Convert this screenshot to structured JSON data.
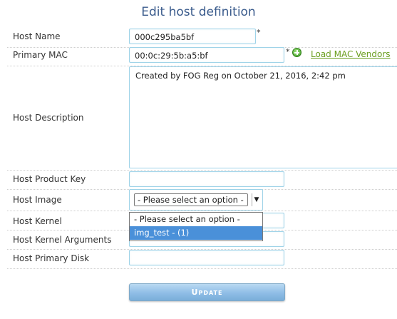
{
  "title": "Edit host definition",
  "fields": {
    "host_name": {
      "label": "Host Name",
      "value": "000c295ba5bf",
      "required": "*"
    },
    "primary_mac": {
      "label": "Primary MAC",
      "value": "00:0c:29:5b:a5:bf",
      "required": "*",
      "link": "Load MAC Vendors"
    },
    "description": {
      "label": "Host Description",
      "value": "Created by FOG Reg on October 21, 2016, 2:42 pm"
    },
    "product_key": {
      "label": "Host Product Key",
      "value": ""
    },
    "image": {
      "label": "Host Image",
      "selected": "- Please select an option -",
      "options": [
        "- Please select an option -",
        "img_test - (1)"
      ]
    },
    "kernel": {
      "label": "Host Kernel",
      "value": ""
    },
    "kernel_args": {
      "label": "Host Kernel Arguments",
      "value": ""
    },
    "primary_disk": {
      "label": "Host Primary Disk",
      "value": ""
    }
  },
  "buttons": {
    "update": "Update"
  },
  "icons": {
    "add_mac": "plus-circle-icon",
    "select_arrow": "chevron-down-icon"
  },
  "colors": {
    "accent": "#3a5b8c",
    "link": "#6b9e1f",
    "button": "#8fbde6"
  }
}
